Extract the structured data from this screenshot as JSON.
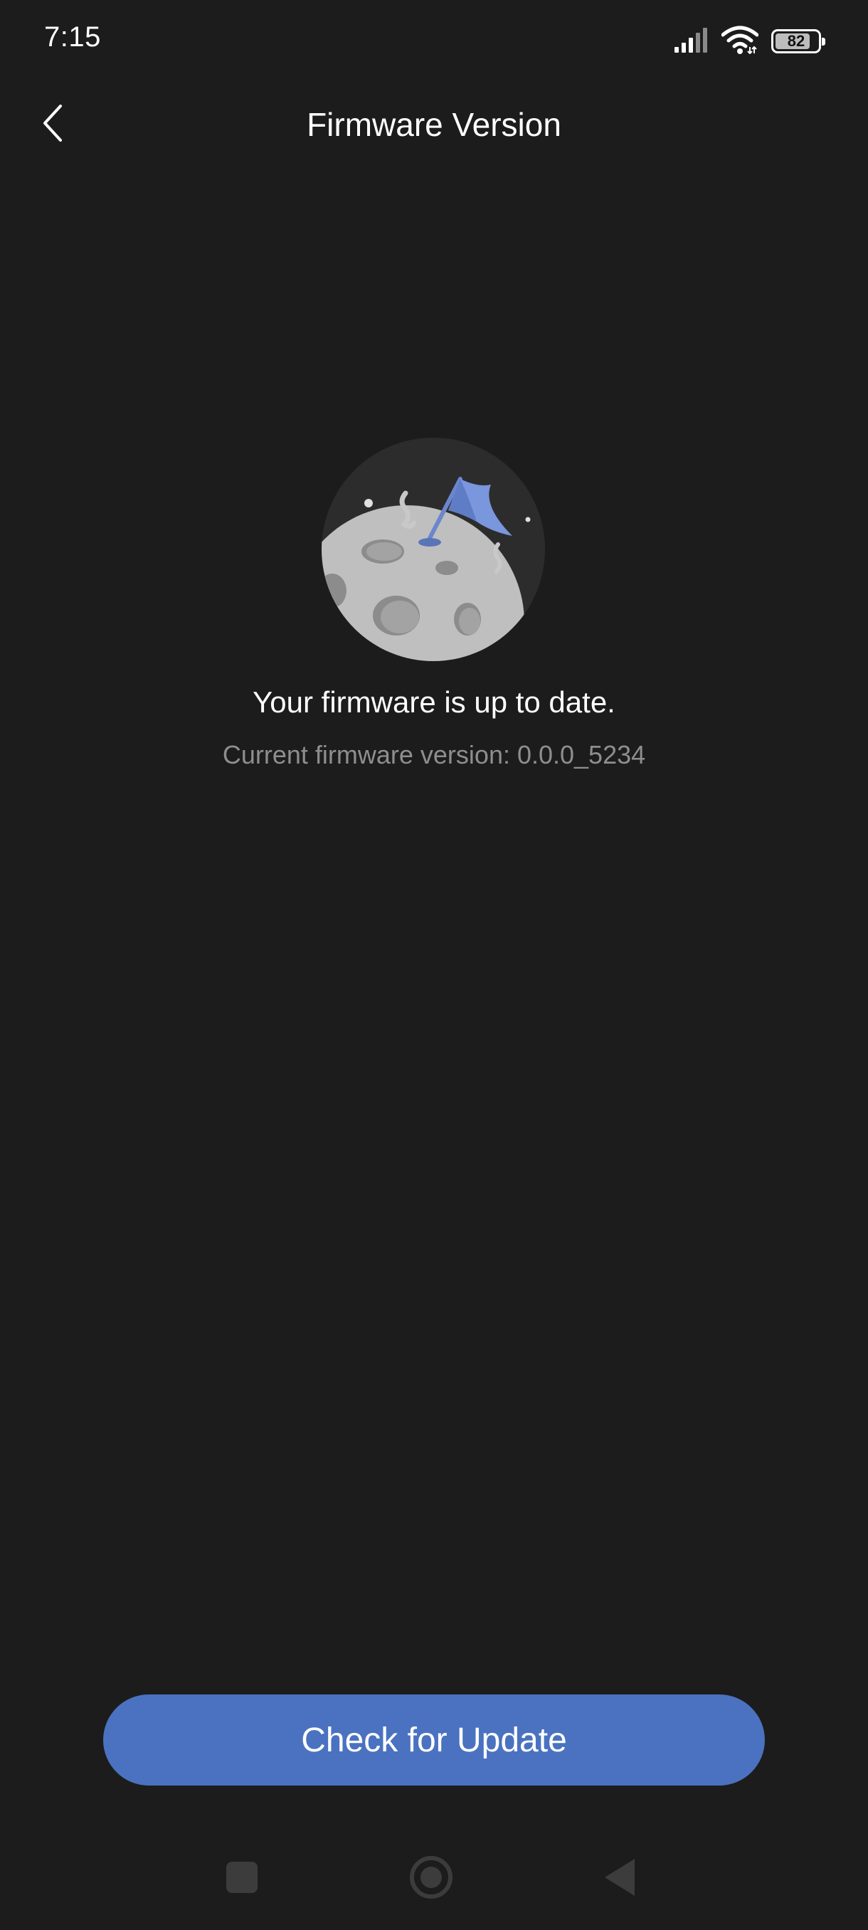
{
  "status_bar": {
    "time": "7:15",
    "battery_level": "82",
    "battery_fraction": 0.82,
    "icons": [
      "signal-icon",
      "wifi-icon",
      "battery-icon"
    ]
  },
  "header": {
    "title": "Firmware Version",
    "back_icon": "chevron-left-icon"
  },
  "main": {
    "illustration": "moon-flag-illustration",
    "status_message": "Your firmware is up to date.",
    "version_text": "Current firmware version: 0.0.0_5234"
  },
  "actions": {
    "check_update_label": "Check for Update"
  },
  "nav_bar": {
    "icons": [
      "recent-apps-icon",
      "home-icon",
      "back-nav-icon"
    ]
  },
  "colors": {
    "background": "#1c1c1c",
    "accent": "#4a72c0",
    "secondary_text": "#8e8e8e"
  }
}
